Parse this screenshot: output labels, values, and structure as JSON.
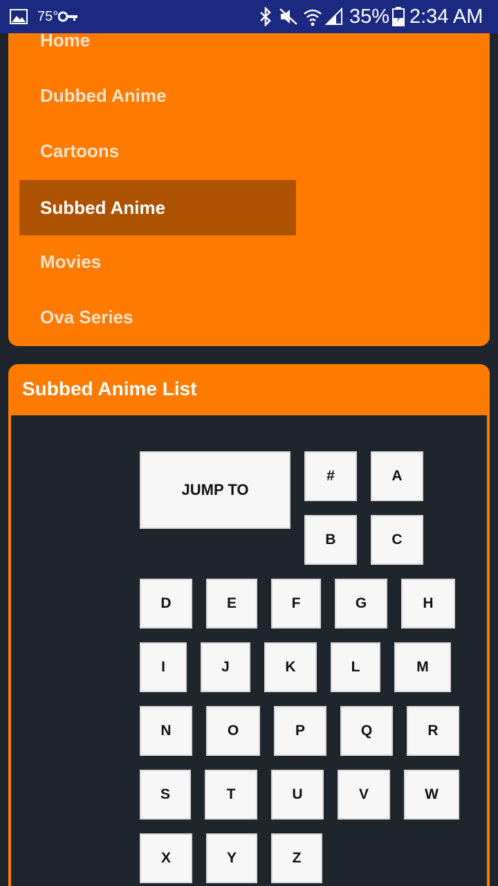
{
  "status_bar": {
    "temperature": "75°",
    "battery_percent": "35%",
    "time": "2:34 AM",
    "icons": [
      "gallery-icon",
      "key-icon",
      "bluetooth-icon",
      "mute-icon",
      "wifi-icon",
      "signal-icon",
      "battery-icon"
    ]
  },
  "nav": {
    "items": [
      {
        "label": "Home"
      },
      {
        "label": "Dubbed Anime"
      },
      {
        "label": "Cartoons"
      },
      {
        "label": "Subbed Anime",
        "active": true
      },
      {
        "label": "Movies"
      },
      {
        "label": "Ova Series"
      }
    ]
  },
  "list": {
    "title": "Subbed Anime List",
    "jump_label": "JUMP TO",
    "letters": [
      "#",
      "A",
      "B",
      "C",
      "D",
      "E",
      "F",
      "G",
      "H",
      "I",
      "J",
      "K",
      "L",
      "M",
      "N",
      "O",
      "P",
      "Q",
      "R",
      "S",
      "T",
      "U",
      "V",
      "W",
      "X",
      "Y",
      "Z"
    ]
  },
  "colors": {
    "accent": "#ff7b00",
    "active_item": "#ad5200",
    "background": "#1f252d",
    "status_bar": "#1b2a80"
  }
}
